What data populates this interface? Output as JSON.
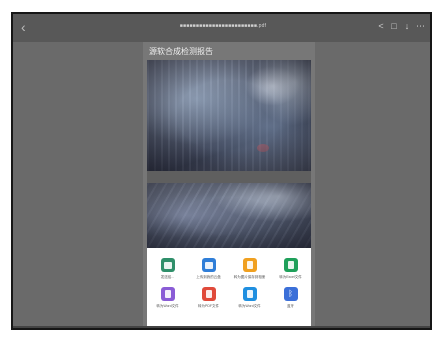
{
  "browser": {
    "back_glyph": "‹",
    "url": "■■■■■■■■■■■■■■■■■■■■■■■■.pdf",
    "actions": [
      {
        "name": "share-icon",
        "glyph": "<"
      },
      {
        "name": "bookmark-icon",
        "glyph": "□"
      },
      {
        "name": "download-icon",
        "glyph": "↓"
      },
      {
        "name": "more-icon",
        "glyph": "⋯"
      }
    ]
  },
  "document": {
    "title": "源软合成检测报告"
  },
  "share_sheet": {
    "items": [
      {
        "label": "发送给...",
        "color": "#2f8f6a",
        "icon": "message-icon"
      },
      {
        "label": "上传到我的云盘",
        "color": "#2f7ed8",
        "icon": "cloud-icon"
      },
      {
        "label": "转为图片保存到相册",
        "color": "#f0a020",
        "icon": "image-icon"
      },
      {
        "label": "转为Excel文件",
        "color": "#1fa05a",
        "icon": "excel-icon"
      },
      {
        "label": "转为Word文件",
        "color": "#8a5cd6",
        "icon": "word-icon"
      },
      {
        "label": "转为PDF文件",
        "color": "#e04a3a",
        "icon": "pdf-icon"
      },
      {
        "label": "转为Word文件",
        "color": "#1f8fe0",
        "icon": "doc-icon"
      },
      {
        "label": "蓝牙",
        "color": "#3b6fd8",
        "icon": "bluetooth-icon"
      }
    ]
  }
}
